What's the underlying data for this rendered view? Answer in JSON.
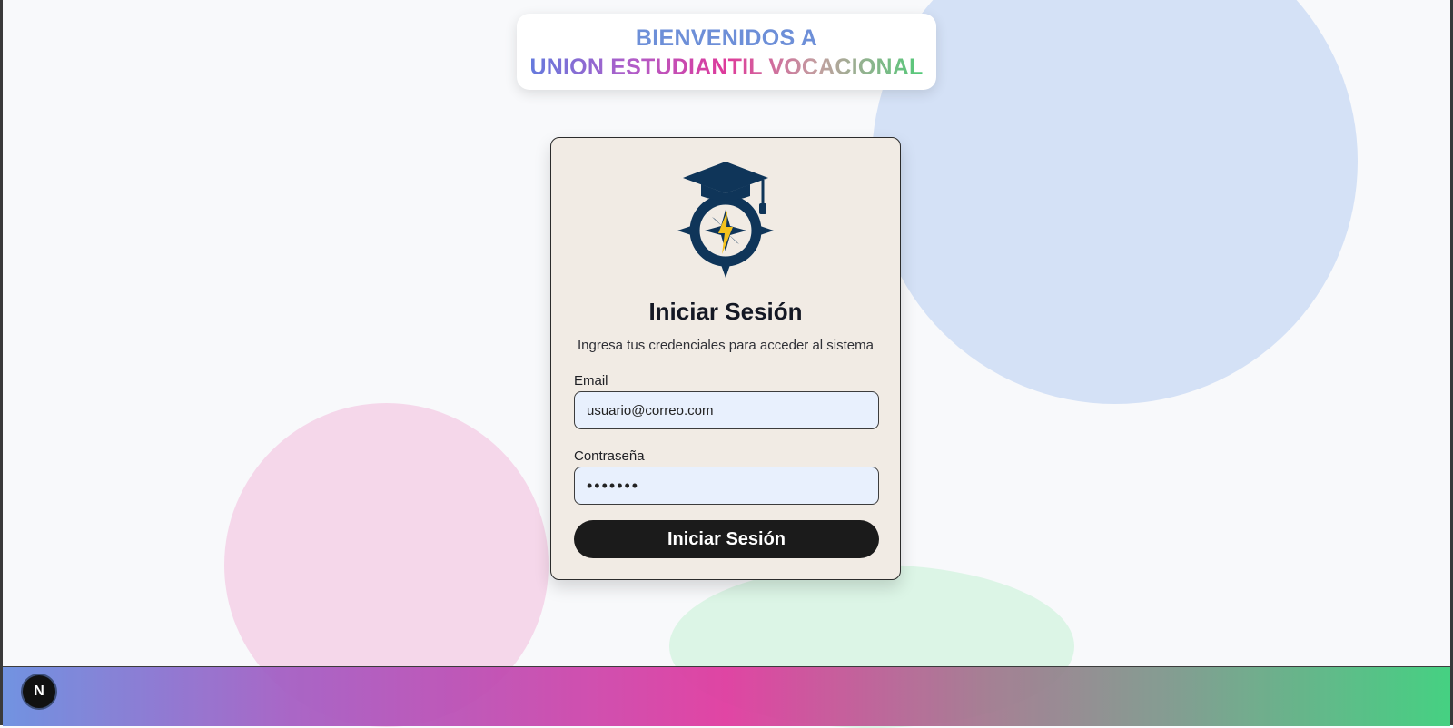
{
  "banner": {
    "line1": "BIENVENIDOS A",
    "line2": "UNION ESTUDIANTIL VOCACIONAL"
  },
  "login": {
    "title": "Iniciar Sesión",
    "subtitle": "Ingresa tus credenciales para acceder al sistema",
    "email_label": "Email",
    "email_value": "usuario@correo.com",
    "password_label": "Contraseña",
    "password_value": "•••••••",
    "submit_label": "Iniciar Sesión"
  },
  "logo": {
    "icon": "graduation-cap-compass-icon"
  },
  "dev_badge": {
    "label": "N",
    "icon": "nextjs-icon"
  },
  "colors": {
    "card_bg": "#f1ebe4",
    "input_bg": "#e8f0fd",
    "button_bg": "#1b1b1b",
    "logo_navy": "#0f3559",
    "logo_gold": "#f4c21c"
  }
}
